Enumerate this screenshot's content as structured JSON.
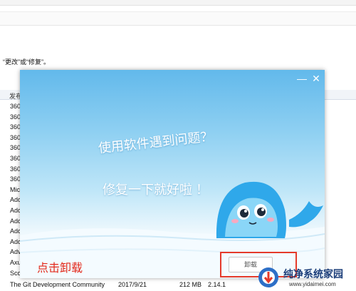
{
  "background_window": {
    "hint_text": "“更改”或“修复”。",
    "column_publisher": "发布",
    "rows": [
      "360",
      "360",
      "360",
      "360",
      "360",
      "360",
      "360",
      "360",
      "Mic",
      "Ado",
      "Ado",
      "Ado",
      "Ado",
      "Ado",
      "Adv",
      "Axu",
      "Sco"
    ],
    "last_row": {
      "name": "The Git Development Community",
      "date": "2017/9/21",
      "size": "212 MB",
      "version": "2.14.1"
    }
  },
  "dialog": {
    "minimize_glyph": "—",
    "close_glyph": "✕",
    "question_text": "使用软件遇到问题？",
    "reassure_text": "修复一下就好啦 ！",
    "uninstall_label": "卸载",
    "annotation_text": "点击卸载",
    "colors": {
      "sky": "#62b9eb",
      "accent_red": "#e53a2a",
      "mascot_blue": "#2fa8ea"
    }
  },
  "watermark": {
    "title": "纯净系统家园",
    "url": "www.yidaimei.com"
  }
}
